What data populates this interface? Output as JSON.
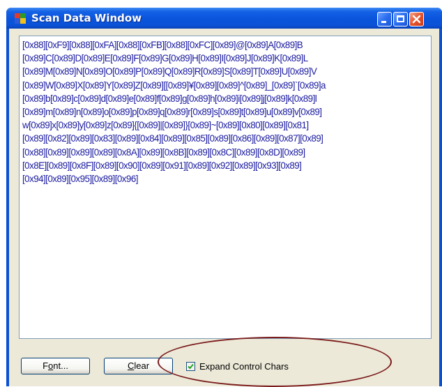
{
  "window": {
    "title": "Scan Data Window",
    "icon": "app-window-icon",
    "controls": [
      "minimize-icon",
      "maximize-icon",
      "close-icon"
    ]
  },
  "scan_text": [
    "[0x88][0xF9][0x88][0xFA][0x88][0xFB][0x88][0xFC][0x89]@[0x89]A[0x89]B",
    "[0x89]C[0x89]D[0x89]E[0x89]F[0x89]G[0x89]H[0x89]I[0x89]J[0x89]K[0x89]L",
    "[0x89]M[0x89]N[0x89]O[0x89]P[0x89]Q[0x89]R[0x89]S[0x89]T[0x89]U[0x89]V",
    "[0x89]W[0x89]X[0x89]Y[0x89]Z[0x89][[0x89]¥[0x89][0x89]^[0x89]_[0x89]`[0x89]a",
    "[0x89]b[0x89]c[0x89]d[0x89]e[0x89]f[0x89]g[0x89]h[0x89]i[0x89]j[0x89]k[0x89]l",
    "[0x89]m[0x89]n[0x89]o[0x89]p[0x89]q[0x89]r[0x89]s[0x89]t[0x89]u[0x89]v[0x89]",
    "w[0x89]x[0x89]y[0x89]z[0x89]{[0x89]|[0x89]}[0x89]~[0x89][0x80][0x89][0x81]",
    "[0x89][0x82][0x89][0x83][0x89][0x84][0x89][0x85][0x89][0x86][0x89][0x87][0x89]",
    "[0x88][0x89][0x89][0x89][0x8A][0x89][0x8B][0x89][0x8C][0x89][0x8D][0x89]",
    "[0x8E][0x89][0x8F][0x89][0x90][0x89][0x91][0x89][0x92][0x89][0x93][0x89]",
    "[0x94][0x89][0x95][0x89][0x96]"
  ],
  "buttons": {
    "font": {
      "label_mnemonic": "o",
      "label_pre": "F",
      "label_post": "nt..."
    },
    "clear": {
      "label_mnemonic": "C",
      "label_pre": "",
      "label_post": "lear"
    }
  },
  "expand_control_chars": {
    "label": "Expand Control Chars",
    "checked": true
  },
  "colors": {
    "titlebar": "#0a55dc",
    "text": "#1a1aa0",
    "annotation_circle": "#7a1a1a"
  }
}
